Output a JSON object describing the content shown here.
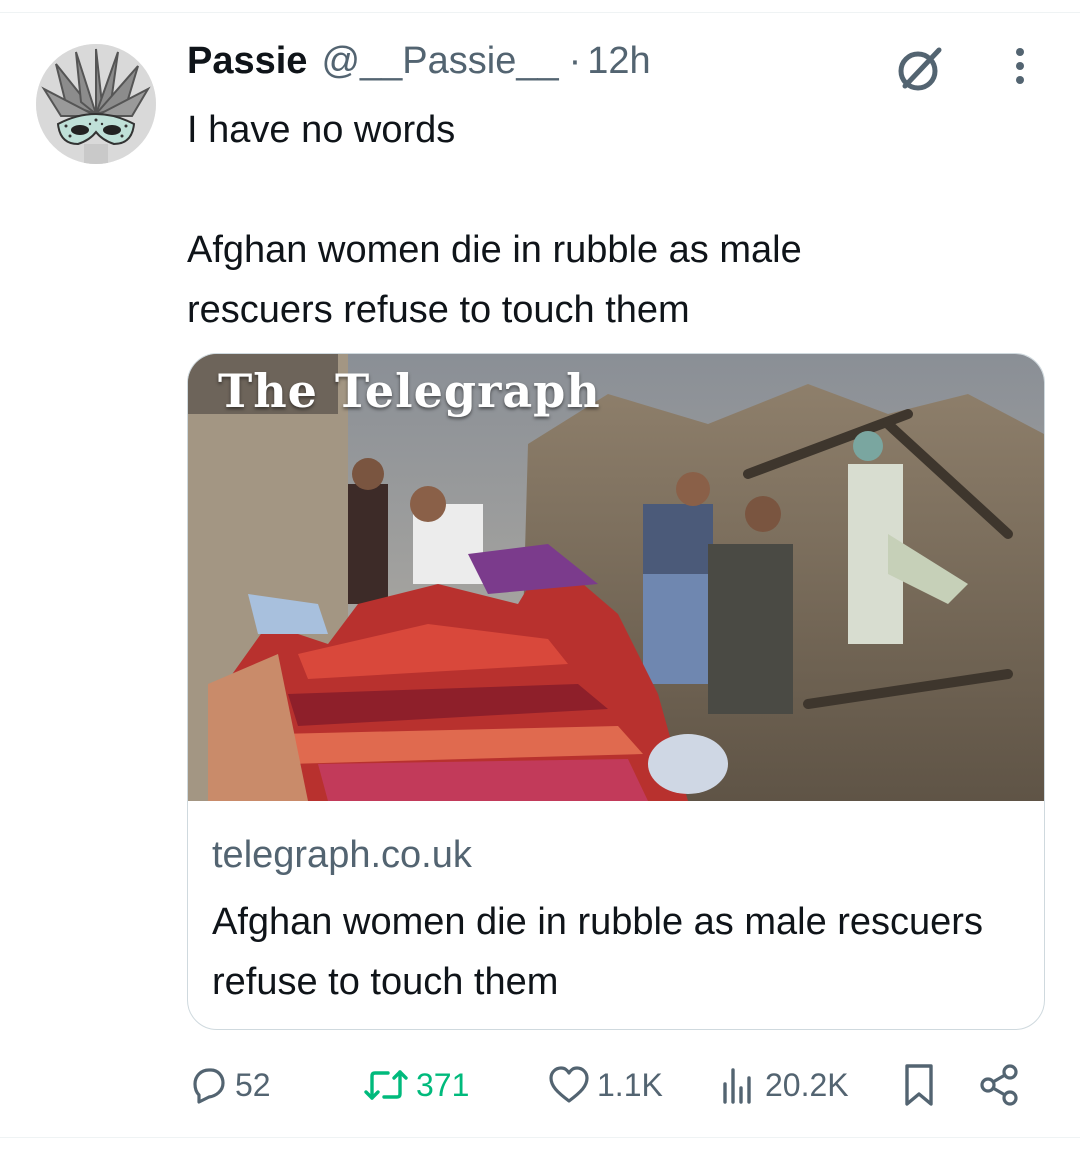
{
  "author": {
    "display_name": "Passie",
    "handle": "@__Passie__",
    "separator": "·",
    "time": "12h"
  },
  "tweet": {
    "line1": "I have no words",
    "line2": "Afghan women die in rubble as male rescuers refuse to touch them"
  },
  "card": {
    "masthead": "The Telegraph",
    "domain": "telegraph.co.uk",
    "title": "Afghan women die in rubble as male rescuers refuse to touch them"
  },
  "actions": {
    "replies": "52",
    "retweets": "371",
    "likes": "1.1K",
    "views": "20.2K"
  },
  "colors": {
    "text_primary": "#0f1419",
    "text_secondary": "#536471",
    "retweet_green": "#00ba7c",
    "border": "#cfd9de"
  },
  "icons": [
    "grok-icon",
    "more-icon",
    "reply-icon",
    "retweet-icon",
    "like-icon",
    "views-icon",
    "bookmark-icon",
    "share-icon"
  ]
}
